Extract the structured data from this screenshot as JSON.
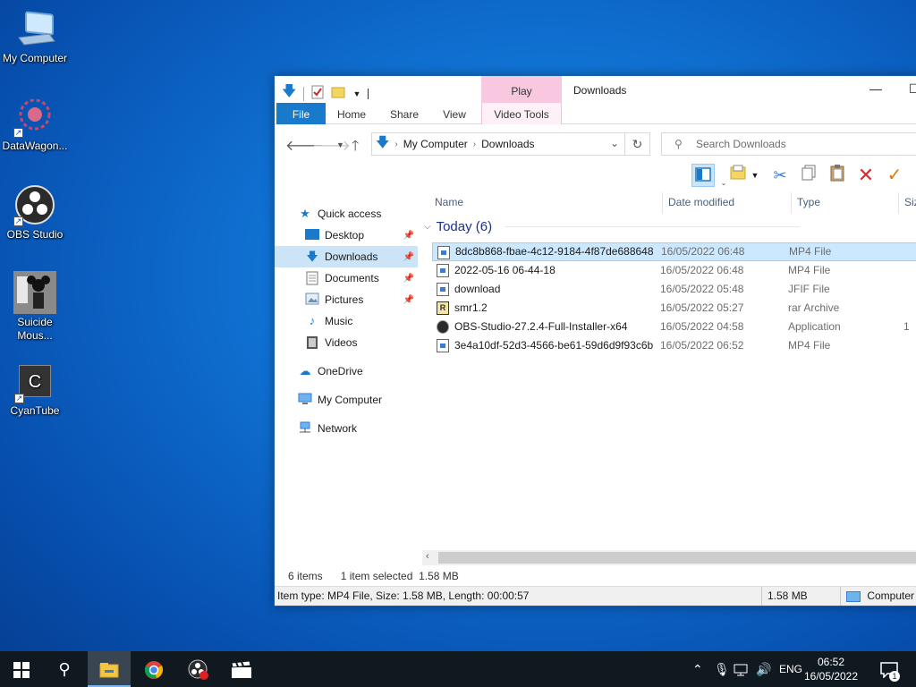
{
  "desktop": {
    "icons": [
      {
        "label": "My Computer"
      },
      {
        "label": "DataWagon..."
      },
      {
        "label": "OBS Studio"
      },
      {
        "label": "Suicide Mous..."
      },
      {
        "label": "CyanTube",
        "glyph_letter": "C"
      }
    ]
  },
  "window": {
    "title": "Downloads",
    "context_tab_header": "Play",
    "ribbon_tabs": [
      "File",
      "Home",
      "Share",
      "View",
      "Video Tools"
    ],
    "address": {
      "crumbs": [
        "My Computer",
        "Downloads"
      ]
    },
    "search": {
      "placeholder": "Search Downloads"
    },
    "nav": {
      "quick_access": "Quick access",
      "items": [
        "Desktop",
        "Downloads",
        "Documents",
        "Pictures",
        "Music",
        "Videos"
      ],
      "onedrive": "OneDrive",
      "my_computer": "My Computer",
      "network": "Network"
    },
    "columns": [
      "Name",
      "Date modified",
      "Type",
      "Siz"
    ],
    "group": {
      "label": "Today (6)"
    },
    "files": [
      {
        "name": "8dc8b868-fbae-4c12-9184-4f87de688648",
        "date": "16/05/2022 06:48",
        "type": "MP4 File",
        "size": "",
        "icon": "video-file-icon"
      },
      {
        "name": "2022-05-16 06-44-18",
        "date": "16/05/2022 06:48",
        "type": "MP4 File",
        "size": "",
        "icon": "video-file-icon"
      },
      {
        "name": "download",
        "date": "16/05/2022 05:48",
        "type": "JFIF File",
        "size": "",
        "icon": "image-file-icon"
      },
      {
        "name": "smr1.2",
        "date": "16/05/2022 05:27",
        "type": "rar Archive",
        "size": "",
        "icon": "archive-icon"
      },
      {
        "name": "OBS-Studio-27.2.4-Full-Installer-x64",
        "date": "16/05/2022 04:58",
        "type": "Application",
        "size": "1",
        "icon": "obs-installer-icon"
      },
      {
        "name": "3e4a10df-52d3-4566-be61-59d6d9f93c6b",
        "date": "16/05/2022 06:52",
        "type": "MP4 File",
        "size": "",
        "icon": "video-file-icon"
      }
    ],
    "status": {
      "count": "6 items",
      "selection": "1 item selected  1.58 MB"
    },
    "details_bar": {
      "info": "Item type: MP4 File, Size: 1.58 MB, Length: 00:00:57",
      "size": "1.58 MB",
      "location": "Computer"
    }
  },
  "taskbar": {
    "language": "ENG",
    "time": "06:52",
    "date": "16/05/2022",
    "notification_count": "1"
  },
  "colors": {
    "accent": "#1979ca",
    "selection": "#cce8ff",
    "context_tab": "#f7c8e0",
    "taskbar": "#101820"
  }
}
